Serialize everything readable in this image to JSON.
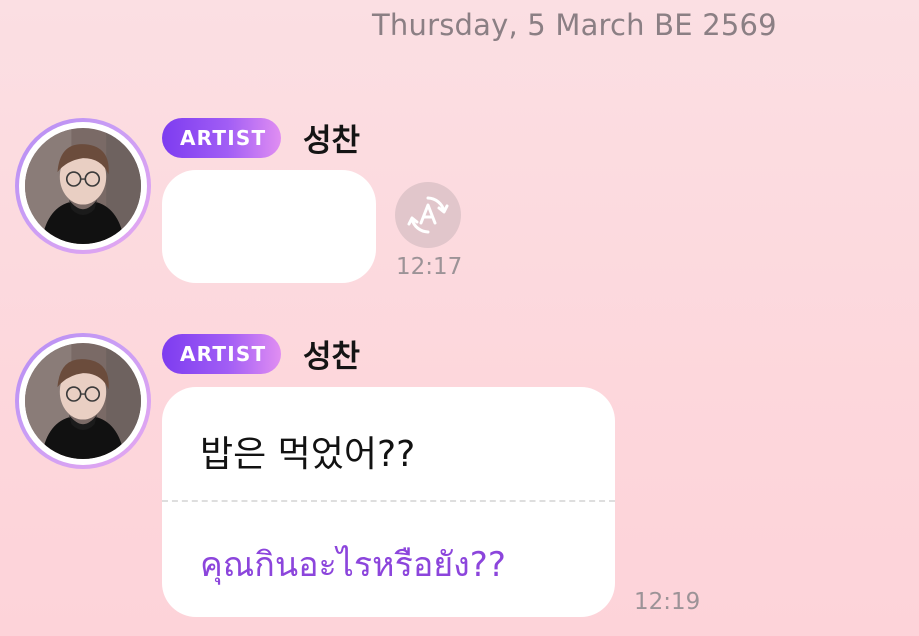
{
  "date_header": "Thursday, 5 March BE 2569",
  "messages": [
    {
      "badge": "ARTIST",
      "sender": "성찬",
      "text": "",
      "time": "12:17",
      "translate_icon": "translate-auto-icon"
    },
    {
      "badge": "ARTIST",
      "sender": "성찬",
      "text": "밥은 먹었어??",
      "translation": "คุณกินอะไรหรือยัง??",
      "time": "12:19"
    }
  ],
  "colors": {
    "badge_start": "#7d3cf0",
    "badge_end": "#e08ef2",
    "translation_text": "#8c45dc",
    "avatar_ring": "#b58cf3",
    "background": "#fbdfe3"
  }
}
